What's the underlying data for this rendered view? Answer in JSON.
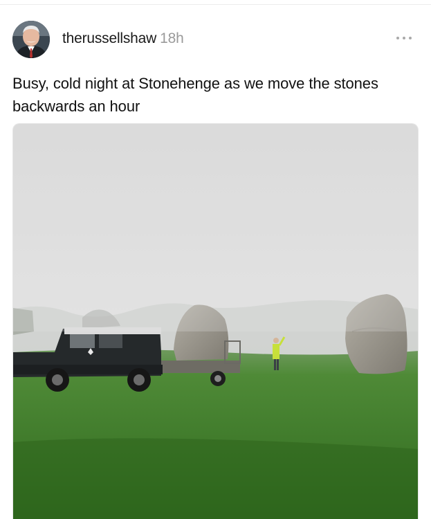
{
  "post": {
    "username": "therussellshaw",
    "timestamp": "18h",
    "caption": "Busy, cold night at Stonehenge as we move the stones backwards an hour",
    "more_icon": "more-horizontal-icon",
    "avatar_icon": "user-avatar"
  },
  "colors": {
    "timestamp": "#9a9a9a",
    "more_dots": "#a9a9a9",
    "fog_sky": "#dcdcdc",
    "grass": "#3f7b2a"
  }
}
